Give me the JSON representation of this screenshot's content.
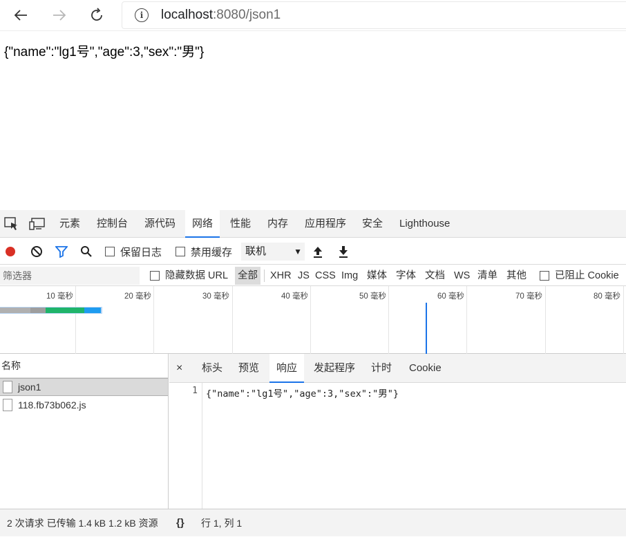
{
  "browser": {
    "url_host": "localhost",
    "url_rest": ":8080/json1"
  },
  "page": {
    "json_text": "{\"name\":\"lg1号\",\"age\":3,\"sex\":\"男\"}"
  },
  "devtools": {
    "tabs": [
      "元素",
      "控制台",
      "源代码",
      "网络",
      "性能",
      "内存",
      "应用程序",
      "安全",
      "Lighthouse"
    ],
    "active_tab": "网络",
    "toolbar": {
      "preserve_log": "保留日志",
      "disable_cache": "禁用缓存",
      "throttle_value": "联机"
    },
    "filter": {
      "placeholder": "筛选器",
      "hide_data_urls": "隐藏数据 URL",
      "types": [
        "全部",
        "XHR",
        "JS",
        "CSS",
        "Img",
        "媒体",
        "字体",
        "文档",
        "WS",
        "清单",
        "其他"
      ],
      "active_type": "全部",
      "blocked_cookies": "已阻止 Cookie"
    },
    "timeline": {
      "ticks": [
        "10 毫秒",
        "20 毫秒",
        "30 毫秒",
        "40 毫秒",
        "50 毫秒",
        "60 毫秒",
        "70 毫秒",
        "80 毫秒"
      ]
    },
    "requests": {
      "header": "名称",
      "items": [
        "json1",
        "118.fb73b062.js"
      ],
      "selected": "json1"
    },
    "detail": {
      "tabs": [
        "标头",
        "预览",
        "响应",
        "发起程序",
        "计时",
        "Cookie"
      ],
      "active_tab": "响应",
      "line_number": "1",
      "code": "{\"name\":\"lg1号\",\"age\":3,\"sex\":\"男\"}",
      "format_icon": "{}",
      "cursor_position": "行 1, 列 1"
    },
    "status": "2 次请求  已传输 1.4 kB  1.2 kB 资源"
  },
  "colors": {
    "accent": "#1a73e8",
    "record": "#d93025"
  }
}
